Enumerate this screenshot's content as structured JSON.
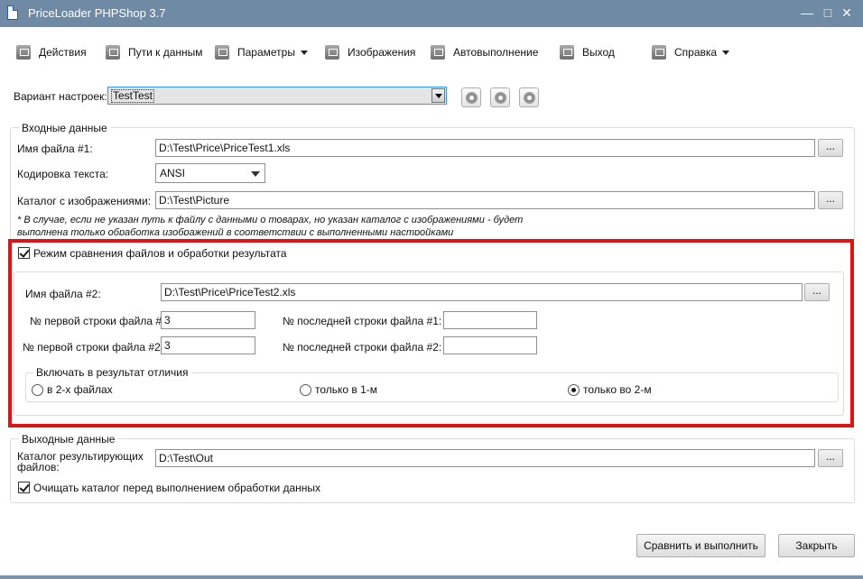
{
  "window": {
    "title": "PriceLoader PHPShop 3.7",
    "minimize": "—",
    "maximize": "□",
    "close": "✕"
  },
  "menu": {
    "items": [
      {
        "label": "Действия",
        "icon": "checklist-icon"
      },
      {
        "label": "Пути к данным",
        "icon": "folder-icon"
      },
      {
        "label": "Параметры",
        "icon": "gear-icon",
        "dropdown": true
      },
      {
        "label": "Изображения",
        "icon": "image-icon"
      },
      {
        "label": "Автовыполнение",
        "icon": "clock-icon"
      },
      {
        "label": "Выход",
        "icon": "exit-icon"
      },
      {
        "label": "Справка",
        "icon": "help-icon",
        "dropdown": true
      }
    ]
  },
  "variant": {
    "label": "Вариант настроек:",
    "value": "TestTest"
  },
  "input_group": {
    "title": "Входные данные",
    "file1_label": "Имя файла #1:",
    "file1_value": "D:\\Test\\Price\\PriceTest1.xls",
    "encoding_label": "Кодировка текста:",
    "encoding_value": "ANSI",
    "images_label": "Каталог с изображениями:",
    "images_value": "D:\\Test\\Picture",
    "note_line1": "* В случае, если не указан путь к файлу с данными о товарах, но указан каталог с изображениями - будет",
    "note_line2": "выполнена только обработка изображений в соответствии с выполненными настройками"
  },
  "compare": {
    "checkbox_label": "Режим сравнения файлов и обработки результата",
    "checked": true,
    "file2_label": "Имя файла #2:",
    "file2_value": "D:\\Test\\Price\\PriceTest2.xls",
    "first_row1_label": "№ первой строки файла #1:",
    "first_row1_value": "3",
    "last_row1_label": "№ последней строки файла #1:",
    "last_row1_value": "",
    "first_row2_label": "№ первой строки файла #2:",
    "first_row2_value": "3",
    "last_row2_label": "№ последней строки файла #2:",
    "last_row2_value": "",
    "diff_group_title": "Включать в результат отличия",
    "radio_both": "в 2-х файлах",
    "radio_first": "только в 1-м",
    "radio_second": "только во 2-м",
    "selected": "radio_second"
  },
  "output_group": {
    "title": "Выходные данные",
    "out_label_line1": "Каталог результирующих",
    "out_label_line2": "файлов:",
    "out_value": "D:\\Test\\Out",
    "clear_label": "Очищать каталог перед выполнением обработки данных",
    "clear_checked": true
  },
  "browse_label": "...",
  "buttons": {
    "compare_run": "Сравнить и выполнить",
    "close": "Закрыть"
  }
}
